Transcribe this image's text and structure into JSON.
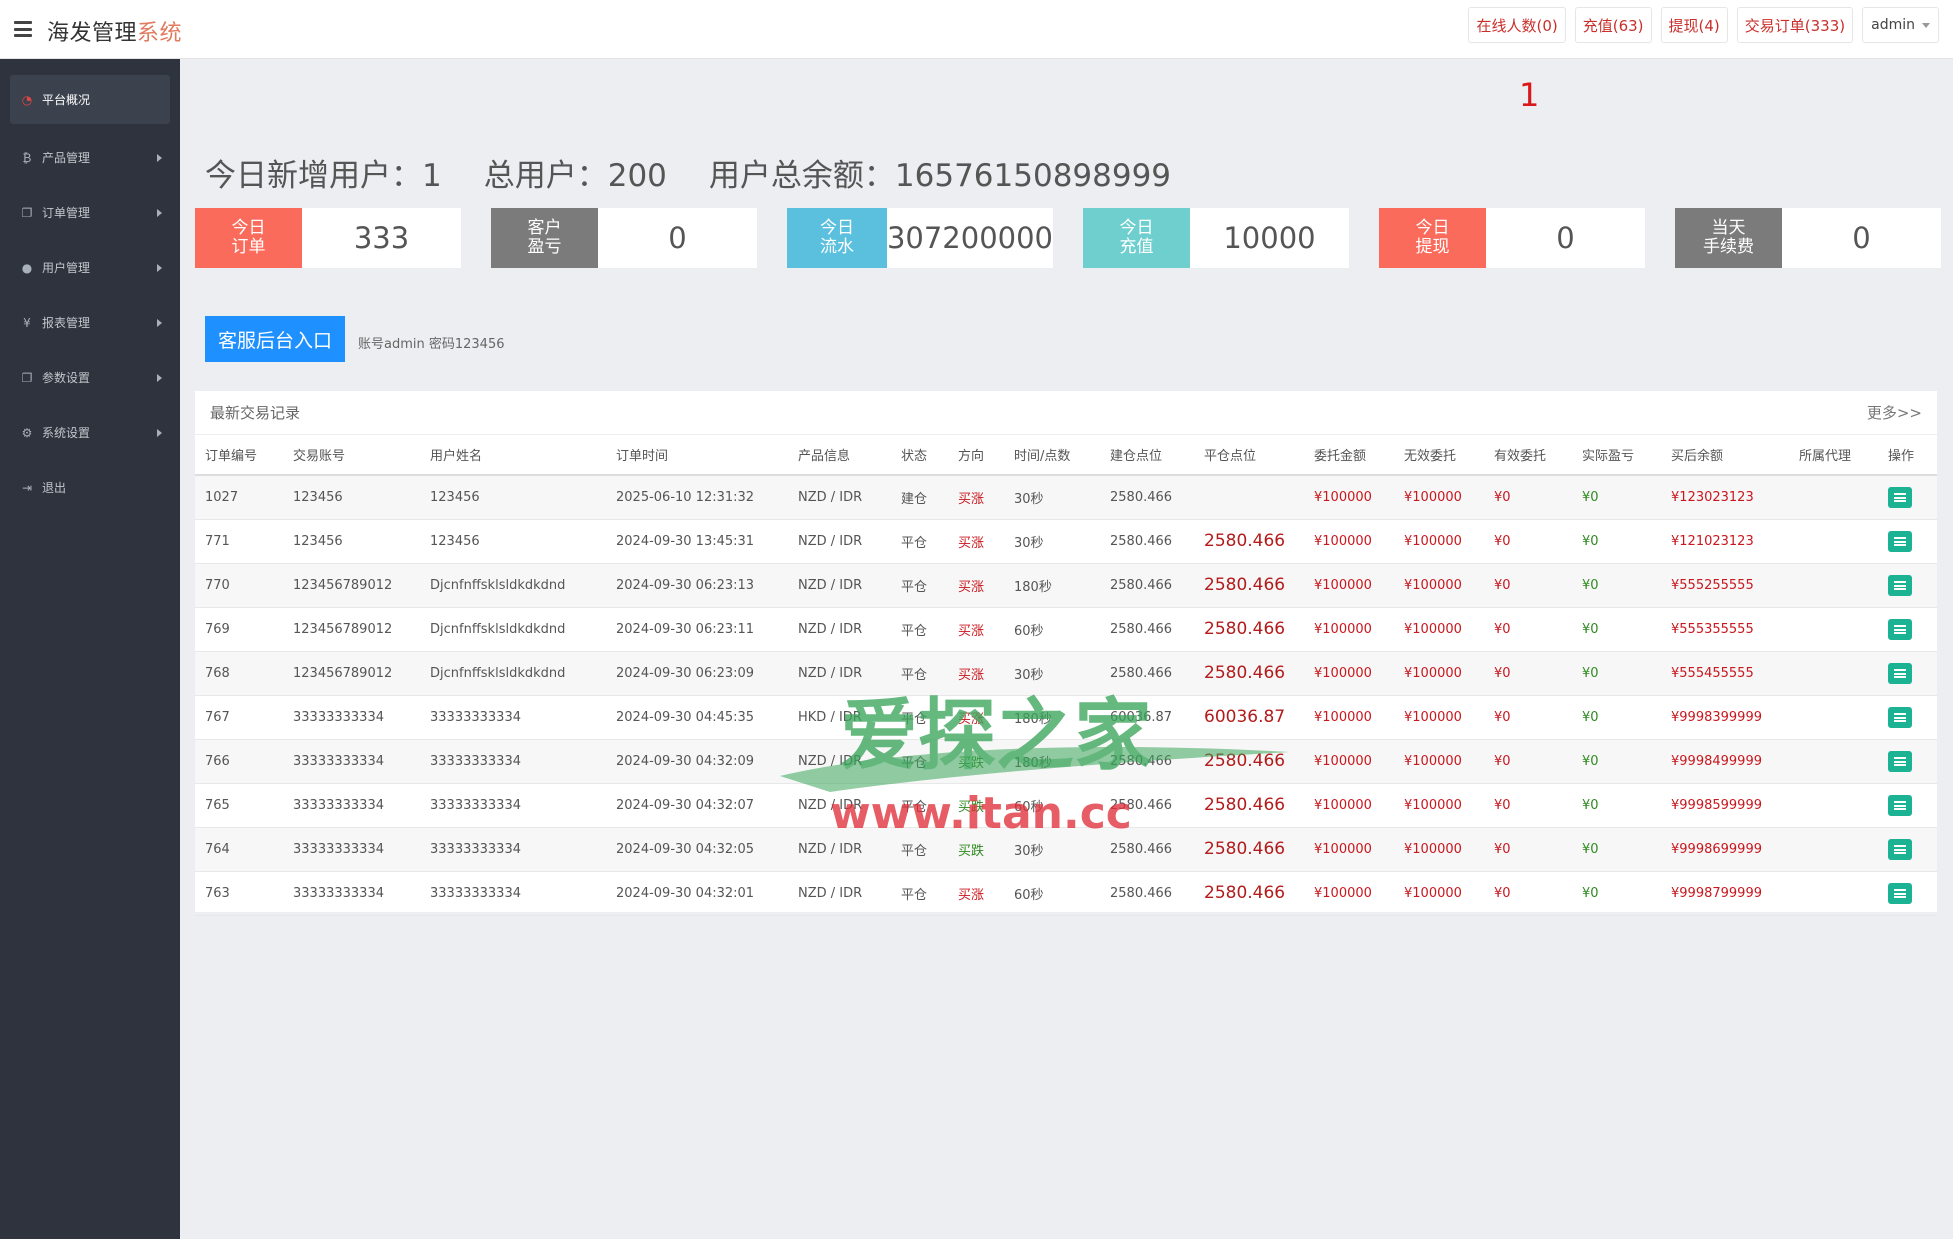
{
  "brand": {
    "main": "海发管理",
    "accent": "系统"
  },
  "topnav": {
    "online": "在线人数(0)",
    "recharge": "充值(63)",
    "withdraw": "提现(4)",
    "orders": "交易订单(333)",
    "user": "admin"
  },
  "sidebar": {
    "items": [
      {
        "label": "平台概况",
        "icon": "dashboard-icon"
      },
      {
        "label": "产品管理",
        "icon": "bitcoin-icon"
      },
      {
        "label": "订单管理",
        "icon": "copy-icon"
      },
      {
        "label": "用户管理",
        "icon": "user-icon"
      },
      {
        "label": "报表管理",
        "icon": "yen-icon"
      },
      {
        "label": "参数设置",
        "icon": "copy-icon"
      },
      {
        "label": "系统设置",
        "icon": "gears-icon"
      },
      {
        "label": "退出",
        "icon": "sign-out-icon"
      }
    ]
  },
  "online_count": "1",
  "summary": {
    "new_users": "今日新增用户：1",
    "total_users": "总用户：200",
    "total_balance": "用户总余额：16576150898999"
  },
  "cards": [
    {
      "label1": "今日",
      "label2": "订单",
      "value": "333",
      "color": "#fb6b5b"
    },
    {
      "label1": "客户",
      "label2": "盈亏",
      "value": "0",
      "color": "#7b7b7b"
    },
    {
      "label1": "今日",
      "label2": "流水",
      "value": "307200000",
      "color": "#5bc0de"
    },
    {
      "label1": "今日",
      "label2": "充值",
      "value": "10000",
      "color": "#6fcfce"
    },
    {
      "label1": "今日",
      "label2": "提现",
      "value": "0",
      "color": "#fb6b5b"
    },
    {
      "label1": "当天",
      "label2": "手续费",
      "value": "0",
      "color": "#7b7b7b"
    }
  ],
  "cs": {
    "button": "客服后台入口",
    "hint": "账号admin 密码123456"
  },
  "panel": {
    "title": "最新交易记录",
    "more": "更多>>"
  },
  "table": {
    "headers": [
      "订单编号",
      "交易账号",
      "用户姓名",
      "订单时间",
      "产品信息",
      "状态",
      "方向",
      "时间/点数",
      "建仓点位",
      "平仓点位",
      "委托金额",
      "无效委托",
      "有效委托",
      "实际盈亏",
      "买后余额",
      "所属代理",
      "操作"
    ],
    "rows": [
      [
        "1027",
        "123456",
        "123456",
        "2025-06-10 12:31:32",
        "NZD / IDR",
        "建仓",
        "买涨",
        "30秒",
        "2580.466",
        "",
        "¥100000",
        "¥100000",
        "¥0",
        "¥0",
        "¥123023123",
        ""
      ],
      [
        "771",
        "123456",
        "123456",
        "2024-09-30 13:45:31",
        "NZD / IDR",
        "平仓",
        "买涨",
        "30秒",
        "2580.466",
        "2580.466",
        "¥100000",
        "¥100000",
        "¥0",
        "¥0",
        "¥121023123",
        ""
      ],
      [
        "770",
        "123456789012",
        "Djcnfnffsklsldkdkdnd",
        "2024-09-30 06:23:13",
        "NZD / IDR",
        "平仓",
        "买涨",
        "180秒",
        "2580.466",
        "2580.466",
        "¥100000",
        "¥100000",
        "¥0",
        "¥0",
        "¥555255555",
        ""
      ],
      [
        "769",
        "123456789012",
        "Djcnfnffsklsldkdkdnd",
        "2024-09-30 06:23:11",
        "NZD / IDR",
        "平仓",
        "买涨",
        "60秒",
        "2580.466",
        "2580.466",
        "¥100000",
        "¥100000",
        "¥0",
        "¥0",
        "¥555355555",
        ""
      ],
      [
        "768",
        "123456789012",
        "Djcnfnffsklsldkdkdnd",
        "2024-09-30 06:23:09",
        "NZD / IDR",
        "平仓",
        "买涨",
        "30秒",
        "2580.466",
        "2580.466",
        "¥100000",
        "¥100000",
        "¥0",
        "¥0",
        "¥555455555",
        ""
      ],
      [
        "767",
        "33333333334",
        "33333333334",
        "2024-09-30 04:45:35",
        "HKD / IDR",
        "平仓",
        "买涨",
        "180秒",
        "60036.87",
        "60036.87",
        "¥100000",
        "¥100000",
        "¥0",
        "¥0",
        "¥9998399999",
        ""
      ],
      [
        "766",
        "33333333334",
        "33333333334",
        "2024-09-30 04:32:09",
        "NZD / IDR",
        "平仓",
        "买跌",
        "180秒",
        "2580.466",
        "2580.466",
        "¥100000",
        "¥100000",
        "¥0",
        "¥0",
        "¥9998499999",
        ""
      ],
      [
        "765",
        "33333333334",
        "33333333334",
        "2024-09-30 04:32:07",
        "NZD / IDR",
        "平仓",
        "买跌",
        "60秒",
        "2580.466",
        "2580.466",
        "¥100000",
        "¥100000",
        "¥0",
        "¥0",
        "¥9998599999",
        ""
      ],
      [
        "764",
        "33333333334",
        "33333333334",
        "2024-09-30 04:32:05",
        "NZD / IDR",
        "平仓",
        "买跌",
        "30秒",
        "2580.466",
        "2580.466",
        "¥100000",
        "¥100000",
        "¥0",
        "¥0",
        "¥9998699999",
        ""
      ],
      [
        "763",
        "33333333334",
        "33333333334",
        "2024-09-30 04:32:01",
        "NZD / IDR",
        "平仓",
        "买涨",
        "60秒",
        "2580.466",
        "2580.466",
        "¥100000",
        "¥100000",
        "¥0",
        "¥0",
        "¥9998799999",
        ""
      ]
    ]
  },
  "watermark": {
    "line1": "爱探之家",
    "line2": "www.itan.cc"
  },
  "colors": {
    "up": "#c9171e",
    "down": "#2f8a1f",
    "accent": "#1e90ff",
    "sidebar": "#2e333d"
  }
}
